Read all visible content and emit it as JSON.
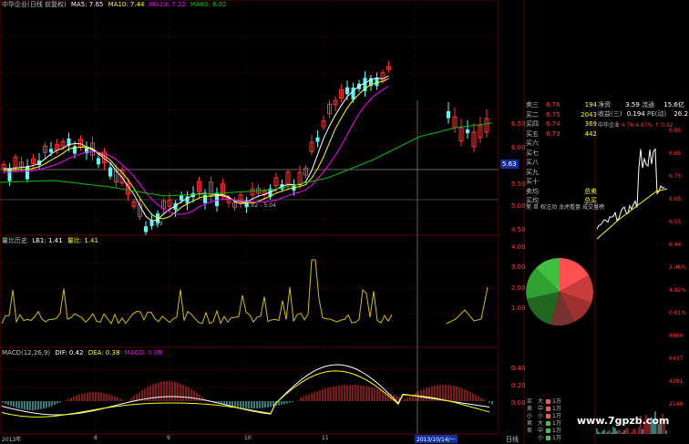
{
  "colors": {
    "bg": "#000000",
    "grid": "#5a0000",
    "up": "#ff3232",
    "down": "#54fcfc",
    "ma5": "#ffffff",
    "ma10": "#ffff00",
    "ma20": "#ff00ff",
    "ma60": "#00c000",
    "vol_line": "#d0c000",
    "dif": "#ffffff",
    "dea": "#ffff00",
    "axis_text": "#ff3c3c",
    "date_text": "#c0c0c0"
  },
  "main_header": {
    "title": "中华企业(日线 前复权)",
    "ma5": "MA5: 7.65",
    "ma10": "MA10: 7.44",
    "ma20": "MA20: 7.22",
    "ma60": "MA60: 6.02"
  },
  "main_axis": {
    "labels": [
      "6.50",
      "6.00",
      "5.50",
      "5.00",
      "4.50"
    ],
    "current_price": "5.63"
  },
  "annotations": {
    "low_price": "4.09",
    "range": "5.02 - 5.04"
  },
  "vol_header": {
    "title": "量比历史",
    "lb1": "LB1: 1.41",
    "lb": "量比: 1.41"
  },
  "vol_axis": {
    "labels": [
      "4.00",
      "3.00",
      "2.00",
      "1.00"
    ]
  },
  "macd_header": {
    "title": "MACD(12,26,9)",
    "dif": "DIF: 0.42",
    "dea": "DEA: 0.38",
    "macd": "MACD: 0.09"
  },
  "macd_axis": {
    "labels": [
      "0.40",
      "0.20",
      "0.00"
    ]
  },
  "date_axis": {
    "labels": [
      "2013年",
      "8",
      "9",
      "10",
      "11"
    ],
    "selected": "2013/10/14/一",
    "period": "日线"
  },
  "order_book": {
    "rows": [
      {
        "label": "卖三",
        "price": "6.76",
        "vol": "194"
      },
      {
        "label": "买二",
        "price": "6.75",
        "vol": "2043"
      },
      {
        "label": "买四",
        "price": "6.74",
        "vol": "369"
      },
      {
        "label": "买五",
        "price": "6.73",
        "vol": "442"
      },
      {
        "label": "买六",
        "price": "",
        "vol": ""
      },
      {
        "label": "买七",
        "price": "",
        "vol": ""
      },
      {
        "label": "买八",
        "price": "",
        "vol": ""
      },
      {
        "label": "买九",
        "price": "",
        "vol": ""
      },
      {
        "label": "买十",
        "price": "",
        "vol": ""
      },
      {
        "label": "卖均",
        "price": "",
        "vol": "总卖"
      },
      {
        "label": "买均",
        "price": "",
        "vol": "总买"
      }
    ]
  },
  "stock_info": {
    "net_assets_label": "净资",
    "net_assets": "3.59",
    "float_label": "流通",
    "float_value": "15.6亿",
    "eps_label": "收益(三)",
    "eps": "0.194",
    "pe_label": "PE(动)",
    "pe": "26.2"
  },
  "mini_chart": {
    "title": "中华企业",
    "price": "6.76",
    "change_pct": "4.97%",
    "change": "0.32",
    "axis_labels": [
      "6.95",
      "6.85",
      "6.75",
      "6.65",
      "6.55",
      "6.44",
      "2.46%",
      "4.92%",
      "0.61%",
      "8969",
      "6437",
      "4291",
      "2146"
    ]
  },
  "tabs": {
    "items": [
      "笔",
      "单",
      "权注动",
      "龙虎看盘",
      "成交量榜"
    ]
  },
  "money_flow": {
    "rows": [
      {
        "side": "买",
        "size": "大",
        "value": "1万"
      },
      {
        "side": "卖",
        "size": "中",
        "value": "1万"
      },
      {
        "side": "小",
        "size": "小",
        "value": "1万"
      },
      {
        "side": "卖",
        "size": "大",
        "value": "1万"
      },
      {
        "side": "卖",
        "size": "中",
        "value": "1万"
      },
      {
        "side": "",
        "size": "小",
        "value": "1万"
      }
    ]
  },
  "watermark": "www.7gpzb.com"
}
